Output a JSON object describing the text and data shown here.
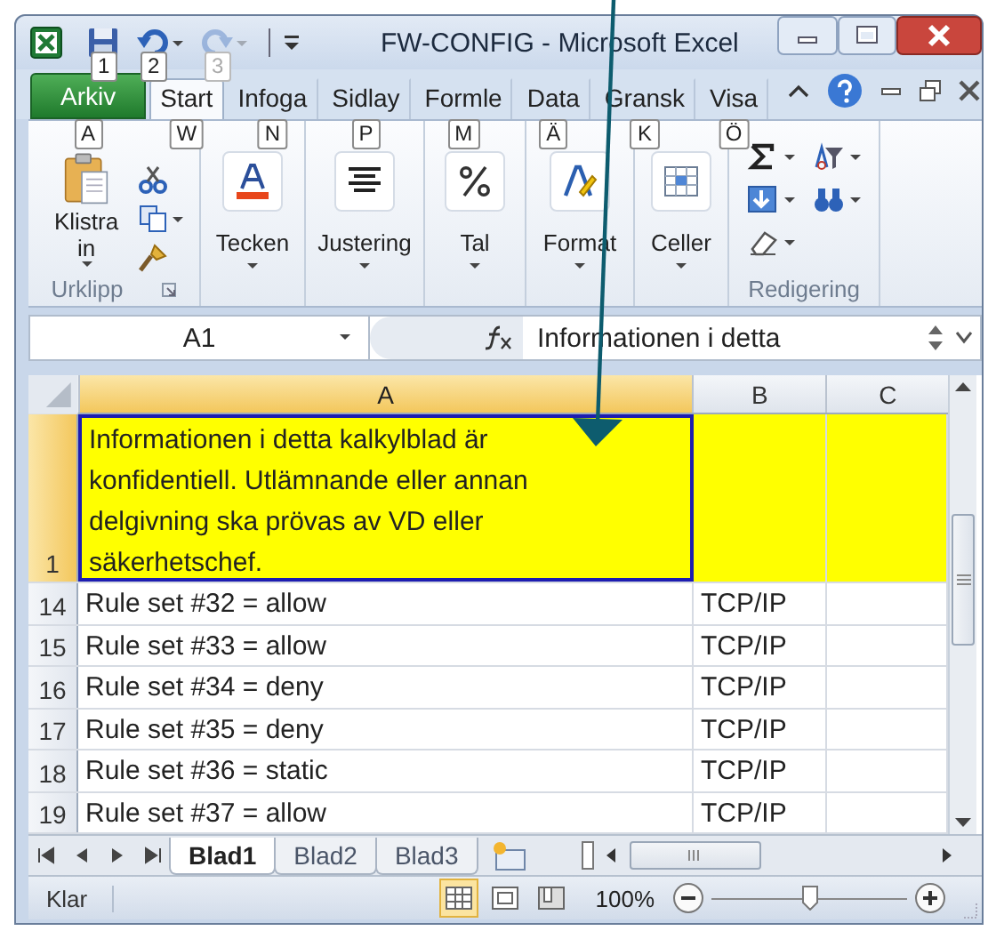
{
  "window": {
    "title": "FW-CONFIG  -  Microsoft Excel"
  },
  "quick_access": [
    {
      "kind": "save",
      "keytip": "1",
      "disabled": false
    },
    {
      "kind": "undo",
      "keytip": "2",
      "disabled": false
    },
    {
      "kind": "redo",
      "keytip": "3",
      "disabled": true
    }
  ],
  "tabs": [
    {
      "label": "Arkiv",
      "keytip": "A",
      "kind": "file",
      "selected": false
    },
    {
      "label": "Start",
      "keytip": "W",
      "kind": "tab",
      "selected": true
    },
    {
      "label": "Infoga",
      "keytip": "N",
      "kind": "tab",
      "selected": false
    },
    {
      "label": "Sidlay",
      "keytip": "P",
      "kind": "tab",
      "selected": false
    },
    {
      "label": "Formle",
      "keytip": "M",
      "kind": "tab",
      "selected": false
    },
    {
      "label": "Data",
      "keytip": "Ä",
      "kind": "tab",
      "selected": false
    },
    {
      "label": "Gransk",
      "keytip": "K",
      "kind": "tab",
      "selected": false
    },
    {
      "label": "Visa",
      "keytip": "Ö",
      "kind": "tab",
      "selected": false
    }
  ],
  "ribbon": {
    "groups": [
      {
        "kind": "clipboard",
        "label": "Urklipp",
        "button": "Klistra in"
      },
      {
        "kind": "font",
        "label": "Tecken"
      },
      {
        "kind": "align",
        "label": "Justering"
      },
      {
        "kind": "number",
        "label": "Tal"
      },
      {
        "kind": "styles",
        "label": "Format"
      },
      {
        "kind": "cells",
        "label": "Celler"
      },
      {
        "kind": "editing",
        "label": "Redigering"
      }
    ]
  },
  "formula_bar": {
    "name_box": "A1",
    "value": "Informationen i detta"
  },
  "sheet": {
    "columns": [
      {
        "label": "A",
        "selected": true
      },
      {
        "label": "B",
        "selected": false
      },
      {
        "label": "C",
        "selected": false
      }
    ],
    "rows": [
      {
        "header": "1",
        "selected": true,
        "highlight": true,
        "cells": [
          "Informationen i detta kalkylblad är konfidentiell. Utlämnande eller annan delgivning ska prövas av VD eller säkerhetschef."
        ]
      },
      {
        "header": "14",
        "selected": false,
        "highlight": false,
        "cells": [
          "Rule set #32 = allow",
          "TCP/IP"
        ]
      },
      {
        "header": "15",
        "selected": false,
        "highlight": false,
        "cells": [
          "Rule set #33 = allow",
          "TCP/IP"
        ]
      },
      {
        "header": "16",
        "selected": false,
        "highlight": false,
        "cells": [
          "Rule set #34 = deny",
          "TCP/IP"
        ]
      },
      {
        "header": "17",
        "selected": false,
        "highlight": false,
        "cells": [
          "Rule set #35 = deny",
          "TCP/IP"
        ]
      },
      {
        "header": "18",
        "selected": false,
        "highlight": false,
        "cells": [
          "Rule set #36 = static",
          "TCP/IP"
        ]
      },
      {
        "header": "19",
        "selected": false,
        "highlight": false,
        "cells": [
          "Rule set #37 = allow",
          "TCP/IP"
        ]
      }
    ]
  },
  "sheet_tabs": [
    {
      "label": "Blad1",
      "selected": true
    },
    {
      "label": "Blad2",
      "selected": false
    },
    {
      "label": "Blad3",
      "selected": false
    }
  ],
  "status_bar": {
    "status": "Klar",
    "views": [
      {
        "kind": "normal",
        "selected": true
      },
      {
        "kind": "layout",
        "selected": false
      },
      {
        "kind": "pagebreak",
        "selected": false
      }
    ],
    "zoom": "100%",
    "zoom_slider": {
      "level": 0.5
    }
  }
}
